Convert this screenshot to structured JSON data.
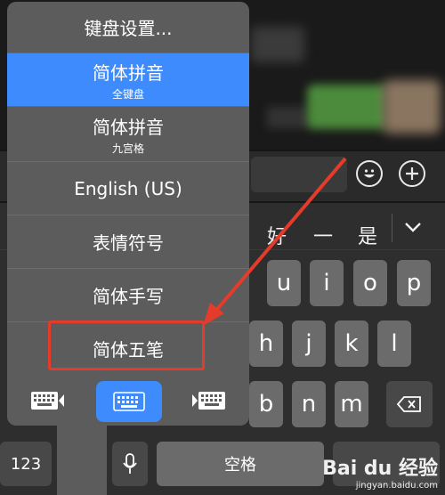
{
  "menu": {
    "items": [
      {
        "title": "键盘设置...",
        "subtitle": ""
      },
      {
        "title": "简体拼音",
        "subtitle": "全键盘",
        "selected": true
      },
      {
        "title": "简体拼音",
        "subtitle": "九宫格"
      },
      {
        "title": "English (US)",
        "subtitle": ""
      },
      {
        "title": "表情符号",
        "subtitle": ""
      },
      {
        "title": "简体手写",
        "subtitle": ""
      },
      {
        "title": "简体五笔",
        "subtitle": ""
      }
    ],
    "layout_buttons": [
      "keyboard-left-icon",
      "keyboard-full-icon",
      "keyboard-right-icon"
    ]
  },
  "candidates": [
    "好",
    "一",
    "是"
  ],
  "keys": {
    "row2": [
      "u",
      "i",
      "o",
      "p"
    ],
    "row3": [
      "h",
      "j",
      "k",
      "l"
    ],
    "row4": [
      "b",
      "n",
      "m"
    ],
    "numbers": "123",
    "space": "空格"
  },
  "colors": {
    "accent": "#3d8bfd",
    "highlight": "#e53b2b"
  },
  "watermark": {
    "brand": "Bai du 经验",
    "url": "jingyan.baidu.com"
  }
}
